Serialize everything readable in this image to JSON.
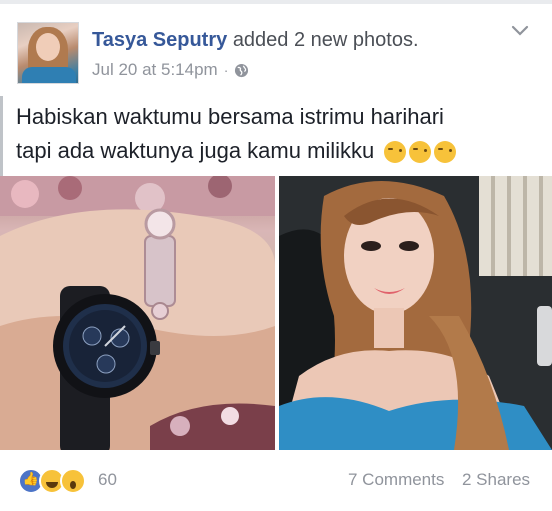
{
  "post": {
    "author_name": "Tasya Seputry",
    "action_text": "added 2 new photos.",
    "timestamp": "Jul 20 at 5:14pm",
    "separator": "·",
    "privacy_icon": "globe-icon",
    "menu_icon": "chevron-down-icon",
    "text_line1": "Habiskan waktumu bersama istrimu harihari",
    "text_line2": "tapi ada waktunya juga kamu milikku",
    "emojis": [
      "kissing-face-emoji",
      "kissing-face-emoji",
      "kissing-face-emoji"
    ]
  },
  "photos": [
    {
      "subject": "wristwatch-photo"
    },
    {
      "subject": "portrait-photo"
    }
  ],
  "footer": {
    "reactions": [
      "like-icon",
      "haha-icon",
      "wow-icon"
    ],
    "reaction_count": "60",
    "comments": "7 Comments",
    "shares": "2 Shares"
  },
  "colors": {
    "link_blue": "#365899",
    "meta_gray": "#90949c",
    "text": "#1d2129"
  }
}
